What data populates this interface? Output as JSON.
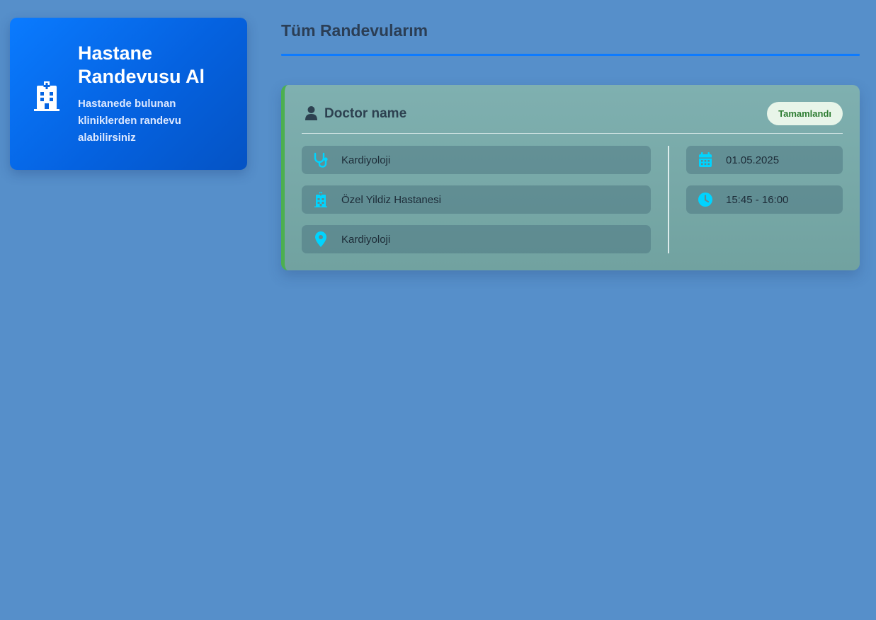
{
  "sidebar": {
    "card": {
      "icon": "hospital-icon",
      "title": "Hastane Randevusu Al",
      "description": "Hastanede bulunan kliniklerden randevu alabilirsiniz"
    }
  },
  "main": {
    "title": "Tüm Randevularım",
    "appointments": [
      {
        "doctor_icon": "user-icon",
        "doctor_name": "Doctor name",
        "status": "Tamamlandı",
        "status_color": "#2e7d32",
        "clinic_icon": "stethoscope-icon",
        "clinic": "Kardiyoloji",
        "hospital_icon": "hospital-icon",
        "hospital": "Özel Yildiz Hastanesi",
        "location_icon": "map-pin-icon",
        "location": "Kardiyoloji",
        "date_icon": "calendar-icon",
        "date": "01.05.2025",
        "time_icon": "clock-icon",
        "time": "15:45 - 16:00"
      }
    ]
  },
  "colors": {
    "background": "#568fca",
    "primary": "#0d7bff",
    "accent_icon": "#00d4ff",
    "completed_border": "#4caf50"
  }
}
